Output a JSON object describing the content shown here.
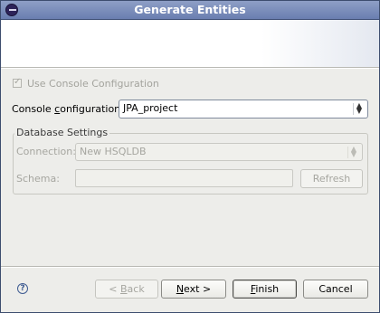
{
  "window": {
    "title": "Generate Entities"
  },
  "use_console_config": {
    "label": "Use Console Configuration",
    "checked": true,
    "enabled": false
  },
  "console_config": {
    "label_pre": "Console ",
    "label_mnemonic": "c",
    "label_post": "onfiguration:",
    "value": "JPA_project"
  },
  "database_settings": {
    "group_title": "Database Settings",
    "connection_label": "Connection:",
    "connection_value": "New HSQLDB",
    "schema_label": "Schema:",
    "schema_value": "",
    "refresh_label": "Refresh"
  },
  "buttons": {
    "back_pre": "< ",
    "back_mnemonic": "B",
    "back_post": "ack",
    "next_mnemonic": "N",
    "next_post": "ext >",
    "finish_mnemonic": "F",
    "finish_post": "inish",
    "cancel": "Cancel"
  },
  "icons": {
    "app": "eclipse-icon",
    "help": "help-icon",
    "check": "checkmark-icon",
    "dropdown": "up-down-arrows-icon"
  }
}
